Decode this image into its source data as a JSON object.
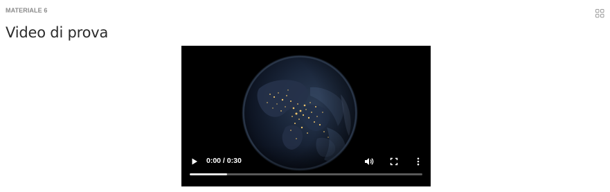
{
  "section": {
    "overline": "MATERIALE 6",
    "title": "Video di prova",
    "layout_toggle_icon": "grid-view-icon"
  },
  "video": {
    "time_display": "0:00 / 0:30",
    "buffered_fraction": 0.16,
    "controls": {
      "play_icon": "play-icon",
      "volume_icon": "volume-icon",
      "fullscreen_icon": "fullscreen-icon",
      "more_icon": "more-vertical-icon"
    }
  },
  "colors": {
    "player_background": "#000000",
    "control_foreground": "#ffffff",
    "overline": "#8a8a8a",
    "title": "#2b2b2b"
  }
}
